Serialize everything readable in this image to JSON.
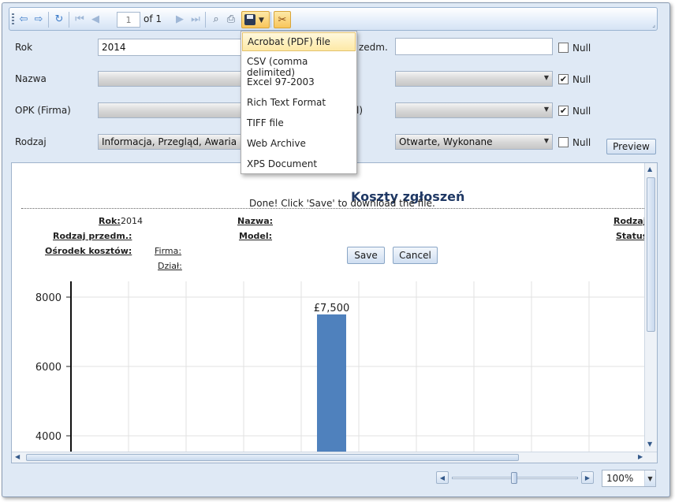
{
  "toolbar": {
    "page_value": "1",
    "page_of": "of 1",
    "icons": [
      "first-page-icon",
      "prev-page-icon",
      "refresh-icon",
      "back-icon",
      "forward-icon",
      "next-page-icon",
      "last-page-icon",
      "find-icon",
      "print-icon",
      "save-icon",
      "tools-icon"
    ]
  },
  "params": {
    "rok_label": "Rok",
    "rok_value": "2014",
    "nazwa_label": "Nazwa",
    "opk_label": "OPK (Firma)",
    "rodzaj_label": "Rodzaj",
    "rodzaj_value": "Informacja, Przegląd, Awaria",
    "right_label_1": "zedm.",
    "right_label_3": "l)",
    "status_value": "Otwarte, Wykonane",
    "null_label": "Null",
    "preview_label": "Preview"
  },
  "export_menu": {
    "items": [
      "Acrobat (PDF) file",
      "CSV (comma delimited)",
      "Excel 97-2003",
      "Rich Text Format",
      "TIFF file",
      "Web Archive",
      "XPS Document"
    ]
  },
  "report": {
    "title": "Koszty zgłoszeń",
    "done_message": "Done! Click 'Save' to download the file.",
    "save_label": "Save",
    "cancel_label": "Cancel",
    "rok_label": "Rok:",
    "rok_value": "2014",
    "nazwa_label": "Nazwa:",
    "rodzaj_label": "Rodzaj:",
    "rodzaj_przedm_label": "Rodzaj przedm.:",
    "model_label": "Model:",
    "status_label": "Status:",
    "osrodek_label": "Ośrodek kosztów:",
    "firma_label": "Firma:",
    "dzial_label": "Dział:"
  },
  "zoom": {
    "value": "100%"
  },
  "chart_data": {
    "type": "bar",
    "categories": [
      "",
      "",
      "",
      "",
      "",
      "",
      "",
      "",
      "",
      ""
    ],
    "values": [
      null,
      null,
      null,
      null,
      7500,
      null,
      null,
      null,
      null,
      null
    ],
    "value_labels": [
      "",
      "",
      "",
      "",
      "£7,500",
      "",
      "",
      "",
      "",
      ""
    ],
    "y_ticks": [
      "8000",
      "6000",
      "4000"
    ],
    "y_tick_values": [
      8000,
      6000,
      4000
    ],
    "ylim": [
      3500,
      8500
    ],
    "grid": true,
    "bar_color": "#4f81bd"
  }
}
